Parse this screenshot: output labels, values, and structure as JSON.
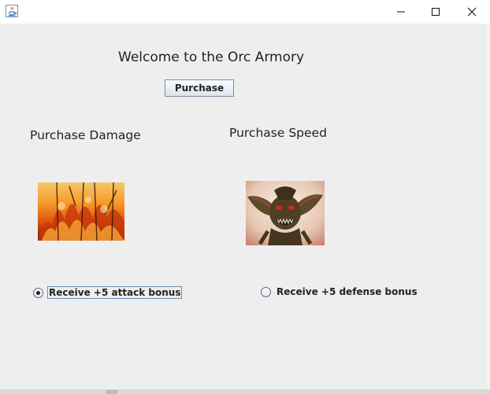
{
  "window": {
    "icon": "java-cup-icon",
    "controls": [
      "minimize-icon",
      "maximize-icon",
      "close-icon"
    ]
  },
  "main": {
    "welcome_text": "Welcome to the Orc Armory",
    "purchase_button_label": "Purchase",
    "damage_section_label": "Purchase Damage",
    "speed_section_label": "Purchase Speed",
    "damage_image": "fire-image",
    "speed_image": "gremlin-image",
    "attack_option": {
      "label": "Receive +5 attack bonus",
      "selected": true
    },
    "defense_option": {
      "label": "Receive +5 defense bonus",
      "selected": false
    }
  },
  "colors": {
    "panel_bg": "#eeeeee",
    "titlebar_bg": "#ffffff"
  }
}
